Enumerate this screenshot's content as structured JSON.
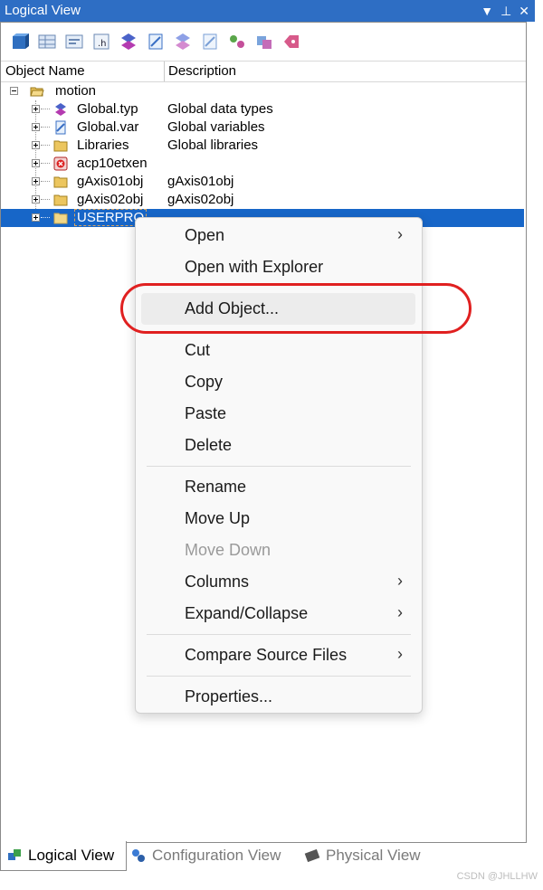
{
  "window": {
    "title": "Logical View",
    "controls": [
      "dropdown-icon",
      "pin-icon",
      "close-icon"
    ]
  },
  "columns": {
    "name": "Object Name",
    "description": "Description"
  },
  "tree": {
    "root": {
      "label": "motion"
    },
    "items": [
      {
        "name": "Global.typ",
        "desc": "Global data types",
        "icon": "datatype-icon"
      },
      {
        "name": "Global.var",
        "desc": "Global variables",
        "icon": "variable-icon"
      },
      {
        "name": "Libraries",
        "desc": "Global libraries",
        "icon": "folder-icon"
      },
      {
        "name": "acp10etxen",
        "desc": "",
        "icon": "error-object-icon"
      },
      {
        "name": "gAxis01obj",
        "desc": "gAxis01obj",
        "icon": "folder-icon"
      },
      {
        "name": "gAxis02obj",
        "desc": "gAxis02obj",
        "icon": "folder-icon"
      },
      {
        "name": "USERPRO",
        "desc": "",
        "icon": "folder-icon"
      }
    ]
  },
  "context_menu": {
    "items": [
      {
        "label": "Open",
        "submenu": true
      },
      {
        "label": "Open with Explorer"
      },
      {
        "label": "Add Object..."
      },
      {
        "label": "Cut"
      },
      {
        "label": "Copy"
      },
      {
        "label": "Paste"
      },
      {
        "label": "Delete"
      },
      {
        "label": "Rename"
      },
      {
        "label": "Move Up"
      },
      {
        "label": "Move Down",
        "disabled": true
      },
      {
        "label": "Columns",
        "submenu": true
      },
      {
        "label": "Expand/Collapse",
        "submenu": true
      },
      {
        "label": "Compare Source Files",
        "submenu": true
      },
      {
        "label": "Properties..."
      }
    ],
    "highlighted_item": "Add Object..."
  },
  "tabs": [
    {
      "label": "Logical View",
      "active": true
    },
    {
      "label": "Configuration View"
    },
    {
      "label": "Physical View"
    }
  ],
  "watermark": "CSDN @JHLLHW",
  "colors": {
    "titlebar": "#2e6ec4",
    "selection": "#1766c8",
    "highlight_ring": "#e02020"
  }
}
